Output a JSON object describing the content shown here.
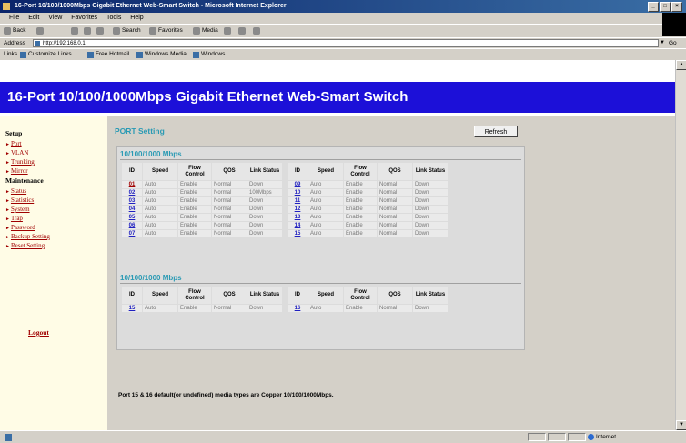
{
  "window": {
    "title": "16-Port 10/100/1000Mbps Gigabit Ethernet Web-Smart Switch - Microsoft Internet Explorer",
    "controls": [
      "_",
      "□",
      "×"
    ]
  },
  "menu": [
    "File",
    "Edit",
    "View",
    "Favorites",
    "Tools",
    "Help"
  ],
  "toolbar": {
    "back": "Back",
    "search": "Search",
    "favorites": "Favorites",
    "media": "Media"
  },
  "address": {
    "label": "Address",
    "url": "http://192.168.0.1",
    "go": "Go"
  },
  "links": {
    "label": "Links",
    "items": [
      "Customize Links",
      "Free Hotmail",
      "Windows Media",
      "Windows"
    ]
  },
  "banner": {
    "title": "16-Port 10/100/1000Mbps Gigabit Ethernet Web-Smart Switch"
  },
  "sidebar": {
    "setup_title": "Setup",
    "setup_items": [
      "Port",
      "VLAN",
      "Trunking",
      "Mirror"
    ],
    "maintenance_title": "Maintenance",
    "maintenance_items": [
      "Status",
      "Statistics",
      "System",
      "Trap",
      "Password",
      "Backup Setting",
      "Reset Setting"
    ],
    "logout": "Logout"
  },
  "main": {
    "title": "PORT Setting",
    "refresh": "Refresh",
    "group1_title": "10/100/1000 Mbps",
    "group2_title": "10/100/1000 Mbps",
    "columns": [
      "ID",
      "Speed",
      "Flow Control",
      "QOS",
      "Link Status"
    ],
    "group1_rows": [
      [
        {
          "id": "01",
          "speed": "Auto",
          "flow": "Enable",
          "qos": "Normal",
          "link": "Down"
        },
        {
          "id": "09",
          "speed": "Auto",
          "flow": "Enable",
          "qos": "Normal",
          "link": "Down"
        }
      ],
      [
        {
          "id": "02",
          "speed": "Auto",
          "flow": "Enable",
          "qos": "Normal",
          "link": "100Mbps"
        },
        {
          "id": "10",
          "speed": "Auto",
          "flow": "Enable",
          "qos": "Normal",
          "link": "Down"
        }
      ],
      [
        {
          "id": "03",
          "speed": "Auto",
          "flow": "Enable",
          "qos": "Normal",
          "link": "Down"
        },
        {
          "id": "11",
          "speed": "Auto",
          "flow": "Enable",
          "qos": "Normal",
          "link": "Down"
        }
      ],
      [
        {
          "id": "04",
          "speed": "Auto",
          "flow": "Enable",
          "qos": "Normal",
          "link": "Down"
        },
        {
          "id": "12",
          "speed": "Auto",
          "flow": "Enable",
          "qos": "Normal",
          "link": "Down"
        }
      ],
      [
        {
          "id": "05",
          "speed": "Auto",
          "flow": "Enable",
          "qos": "Normal",
          "link": "Down"
        },
        {
          "id": "13",
          "speed": "Auto",
          "flow": "Enable",
          "qos": "Normal",
          "link": "Down"
        }
      ],
      [
        {
          "id": "06",
          "speed": "Auto",
          "flow": "Enable",
          "qos": "Normal",
          "link": "Down"
        },
        {
          "id": "14",
          "speed": "Auto",
          "flow": "Enable",
          "qos": "Normal",
          "link": "Down"
        }
      ],
      [
        {
          "id": "07",
          "speed": "Auto",
          "flow": "Enable",
          "qos": "Normal",
          "link": "Down"
        },
        {
          "id": "15",
          "speed": "Auto",
          "flow": "Enable",
          "qos": "Normal",
          "link": "Down"
        }
      ]
    ],
    "group2_rows": [
      [
        {
          "id": "15",
          "speed": "Auto",
          "flow": "Enable",
          "qos": "Normal",
          "link": "Down"
        },
        {
          "id": "16",
          "speed": "Auto",
          "flow": "Enable",
          "qos": "Normal",
          "link": "Down"
        }
      ]
    ],
    "footnote": "Port 15 & 16 default(or undefined) media types are Copper 10/100/1000Mbps."
  },
  "status": {
    "zone": "Internet"
  },
  "colors": {
    "banner": "#1c10d8",
    "sidebar_bg": "#fffce6",
    "link": "#a00000",
    "accent": "#2a9ab4"
  }
}
